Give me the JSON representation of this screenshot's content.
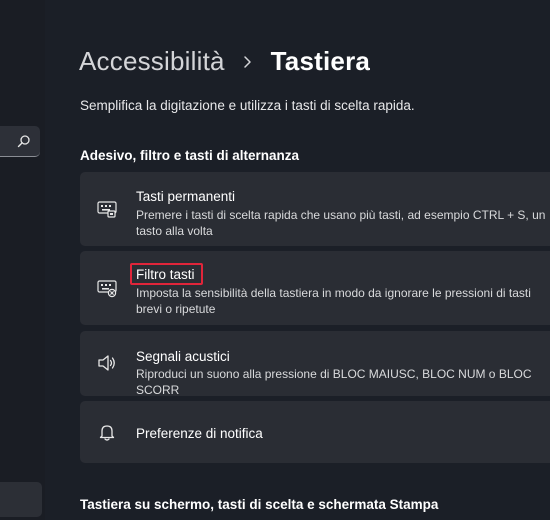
{
  "header": {
    "parent": "Accessibilità",
    "current": "Tastiera",
    "description": "Semplifica la digitazione e utilizza i tasti di scelta rapida."
  },
  "section1": {
    "heading": "Adesivo, filtro e tasti di alternanza",
    "items": [
      {
        "title": "Tasti permanenti",
        "description": "Premere i tasti di scelta rapida che usano più tasti, ad esempio CTRL + S, un tasto alla volta",
        "icon": "sticky-keys-icon"
      },
      {
        "title": "Filtro tasti",
        "description": "Imposta la sensibilità della tastiera in modo da ignorare le pressioni di tasti brevi o ripetute",
        "icon": "filter-keys-icon"
      },
      {
        "title": "Segnali acustici",
        "description": "Riproduci un suono alla pressione di BLOC MAIUSC, BLOC NUM o BLOC SCORR",
        "icon": "speaker-icon"
      },
      {
        "title": "Preferenze di notifica",
        "icon": "bell-icon"
      }
    ]
  },
  "section2": {
    "heading": "Tastiera su schermo, tasti di scelta e schermata Stampa"
  },
  "colors": {
    "background": "#1b1f27",
    "card": "#2a2d34",
    "highlight": "#e0253a"
  }
}
